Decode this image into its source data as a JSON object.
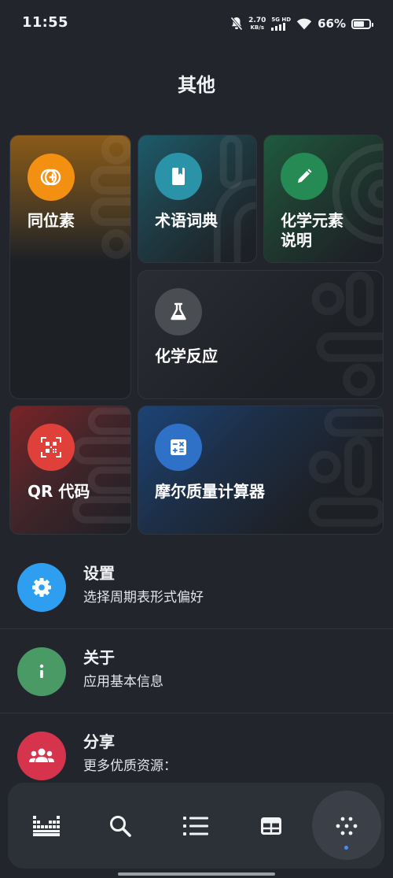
{
  "status_bar": {
    "time": "11:55",
    "net_speed_value": "2.70",
    "net_speed_unit": "KB/s",
    "network_type": "5G HD",
    "battery_percent": "66%",
    "battery_level": 0.66,
    "icons": [
      "mute-bell-icon",
      "signal-icon",
      "wifi-icon",
      "battery-icon"
    ]
  },
  "header": {
    "title": "其他"
  },
  "tiles": [
    {
      "label": "同位素",
      "icon": "isotope-icon",
      "color": "#f39012"
    },
    {
      "label": "术语词典",
      "icon": "book-icon",
      "color": "#2a93a8"
    },
    {
      "label": "化学元素说明",
      "label_line1": "化学元素",
      "label_line2": "说明",
      "icon": "pencil-icon",
      "color": "#268a54"
    },
    {
      "label": "化学反应",
      "icon": "flask-icon",
      "color": "#4a4d52"
    },
    {
      "label": "QR 代码",
      "icon": "qr-code-icon",
      "color": "#e0403a"
    },
    {
      "label": "摩尔质量计算器",
      "icon": "calculator-icon",
      "color": "#2f71c6"
    }
  ],
  "list": [
    {
      "title": "设置",
      "subtitle": "选择周期表形式偏好",
      "icon": "gear-icon",
      "color": "#2e9ff0"
    },
    {
      "title": "关于",
      "subtitle": "应用基本信息",
      "icon": "info-icon",
      "color": "#4a9a66"
    },
    {
      "title": "分享",
      "subtitle": "更多优质资源：",
      "icon": "group-icon",
      "color": "#d6344c"
    }
  ],
  "bottom_nav": {
    "items": [
      "periodic-table-icon",
      "search-icon",
      "list-icon",
      "table-icon",
      "more-dots-icon"
    ],
    "active_index": 4,
    "accent": "#4b8df0"
  }
}
